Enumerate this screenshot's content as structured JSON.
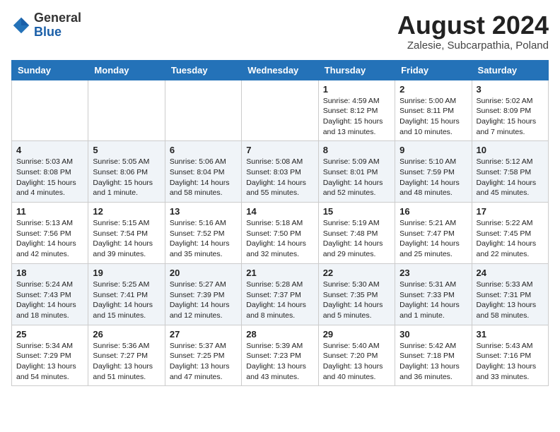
{
  "header": {
    "logo_general": "General",
    "logo_blue": "Blue",
    "month_title": "August 2024",
    "subtitle": "Zalesie, Subcarpathia, Poland"
  },
  "days_of_week": [
    "Sunday",
    "Monday",
    "Tuesday",
    "Wednesday",
    "Thursday",
    "Friday",
    "Saturday"
  ],
  "weeks": [
    [
      {
        "day": "",
        "info": ""
      },
      {
        "day": "",
        "info": ""
      },
      {
        "day": "",
        "info": ""
      },
      {
        "day": "",
        "info": ""
      },
      {
        "day": "1",
        "info": "Sunrise: 4:59 AM\nSunset: 8:12 PM\nDaylight: 15 hours\nand 13 minutes."
      },
      {
        "day": "2",
        "info": "Sunrise: 5:00 AM\nSunset: 8:11 PM\nDaylight: 15 hours\nand 10 minutes."
      },
      {
        "day": "3",
        "info": "Sunrise: 5:02 AM\nSunset: 8:09 PM\nDaylight: 15 hours\nand 7 minutes."
      }
    ],
    [
      {
        "day": "4",
        "info": "Sunrise: 5:03 AM\nSunset: 8:08 PM\nDaylight: 15 hours\nand 4 minutes."
      },
      {
        "day": "5",
        "info": "Sunrise: 5:05 AM\nSunset: 8:06 PM\nDaylight: 15 hours\nand 1 minute."
      },
      {
        "day": "6",
        "info": "Sunrise: 5:06 AM\nSunset: 8:04 PM\nDaylight: 14 hours\nand 58 minutes."
      },
      {
        "day": "7",
        "info": "Sunrise: 5:08 AM\nSunset: 8:03 PM\nDaylight: 14 hours\nand 55 minutes."
      },
      {
        "day": "8",
        "info": "Sunrise: 5:09 AM\nSunset: 8:01 PM\nDaylight: 14 hours\nand 52 minutes."
      },
      {
        "day": "9",
        "info": "Sunrise: 5:10 AM\nSunset: 7:59 PM\nDaylight: 14 hours\nand 48 minutes."
      },
      {
        "day": "10",
        "info": "Sunrise: 5:12 AM\nSunset: 7:58 PM\nDaylight: 14 hours\nand 45 minutes."
      }
    ],
    [
      {
        "day": "11",
        "info": "Sunrise: 5:13 AM\nSunset: 7:56 PM\nDaylight: 14 hours\nand 42 minutes."
      },
      {
        "day": "12",
        "info": "Sunrise: 5:15 AM\nSunset: 7:54 PM\nDaylight: 14 hours\nand 39 minutes."
      },
      {
        "day": "13",
        "info": "Sunrise: 5:16 AM\nSunset: 7:52 PM\nDaylight: 14 hours\nand 35 minutes."
      },
      {
        "day": "14",
        "info": "Sunrise: 5:18 AM\nSunset: 7:50 PM\nDaylight: 14 hours\nand 32 minutes."
      },
      {
        "day": "15",
        "info": "Sunrise: 5:19 AM\nSunset: 7:48 PM\nDaylight: 14 hours\nand 29 minutes."
      },
      {
        "day": "16",
        "info": "Sunrise: 5:21 AM\nSunset: 7:47 PM\nDaylight: 14 hours\nand 25 minutes."
      },
      {
        "day": "17",
        "info": "Sunrise: 5:22 AM\nSunset: 7:45 PM\nDaylight: 14 hours\nand 22 minutes."
      }
    ],
    [
      {
        "day": "18",
        "info": "Sunrise: 5:24 AM\nSunset: 7:43 PM\nDaylight: 14 hours\nand 18 minutes."
      },
      {
        "day": "19",
        "info": "Sunrise: 5:25 AM\nSunset: 7:41 PM\nDaylight: 14 hours\nand 15 minutes."
      },
      {
        "day": "20",
        "info": "Sunrise: 5:27 AM\nSunset: 7:39 PM\nDaylight: 14 hours\nand 12 minutes."
      },
      {
        "day": "21",
        "info": "Sunrise: 5:28 AM\nSunset: 7:37 PM\nDaylight: 14 hours\nand 8 minutes."
      },
      {
        "day": "22",
        "info": "Sunrise: 5:30 AM\nSunset: 7:35 PM\nDaylight: 14 hours\nand 5 minutes."
      },
      {
        "day": "23",
        "info": "Sunrise: 5:31 AM\nSunset: 7:33 PM\nDaylight: 14 hours\nand 1 minute."
      },
      {
        "day": "24",
        "info": "Sunrise: 5:33 AM\nSunset: 7:31 PM\nDaylight: 13 hours\nand 58 minutes."
      }
    ],
    [
      {
        "day": "25",
        "info": "Sunrise: 5:34 AM\nSunset: 7:29 PM\nDaylight: 13 hours\nand 54 minutes."
      },
      {
        "day": "26",
        "info": "Sunrise: 5:36 AM\nSunset: 7:27 PM\nDaylight: 13 hours\nand 51 minutes."
      },
      {
        "day": "27",
        "info": "Sunrise: 5:37 AM\nSunset: 7:25 PM\nDaylight: 13 hours\nand 47 minutes."
      },
      {
        "day": "28",
        "info": "Sunrise: 5:39 AM\nSunset: 7:23 PM\nDaylight: 13 hours\nand 43 minutes."
      },
      {
        "day": "29",
        "info": "Sunrise: 5:40 AM\nSunset: 7:20 PM\nDaylight: 13 hours\nand 40 minutes."
      },
      {
        "day": "30",
        "info": "Sunrise: 5:42 AM\nSunset: 7:18 PM\nDaylight: 13 hours\nand 36 minutes."
      },
      {
        "day": "31",
        "info": "Sunrise: 5:43 AM\nSunset: 7:16 PM\nDaylight: 13 hours\nand 33 minutes."
      }
    ]
  ]
}
